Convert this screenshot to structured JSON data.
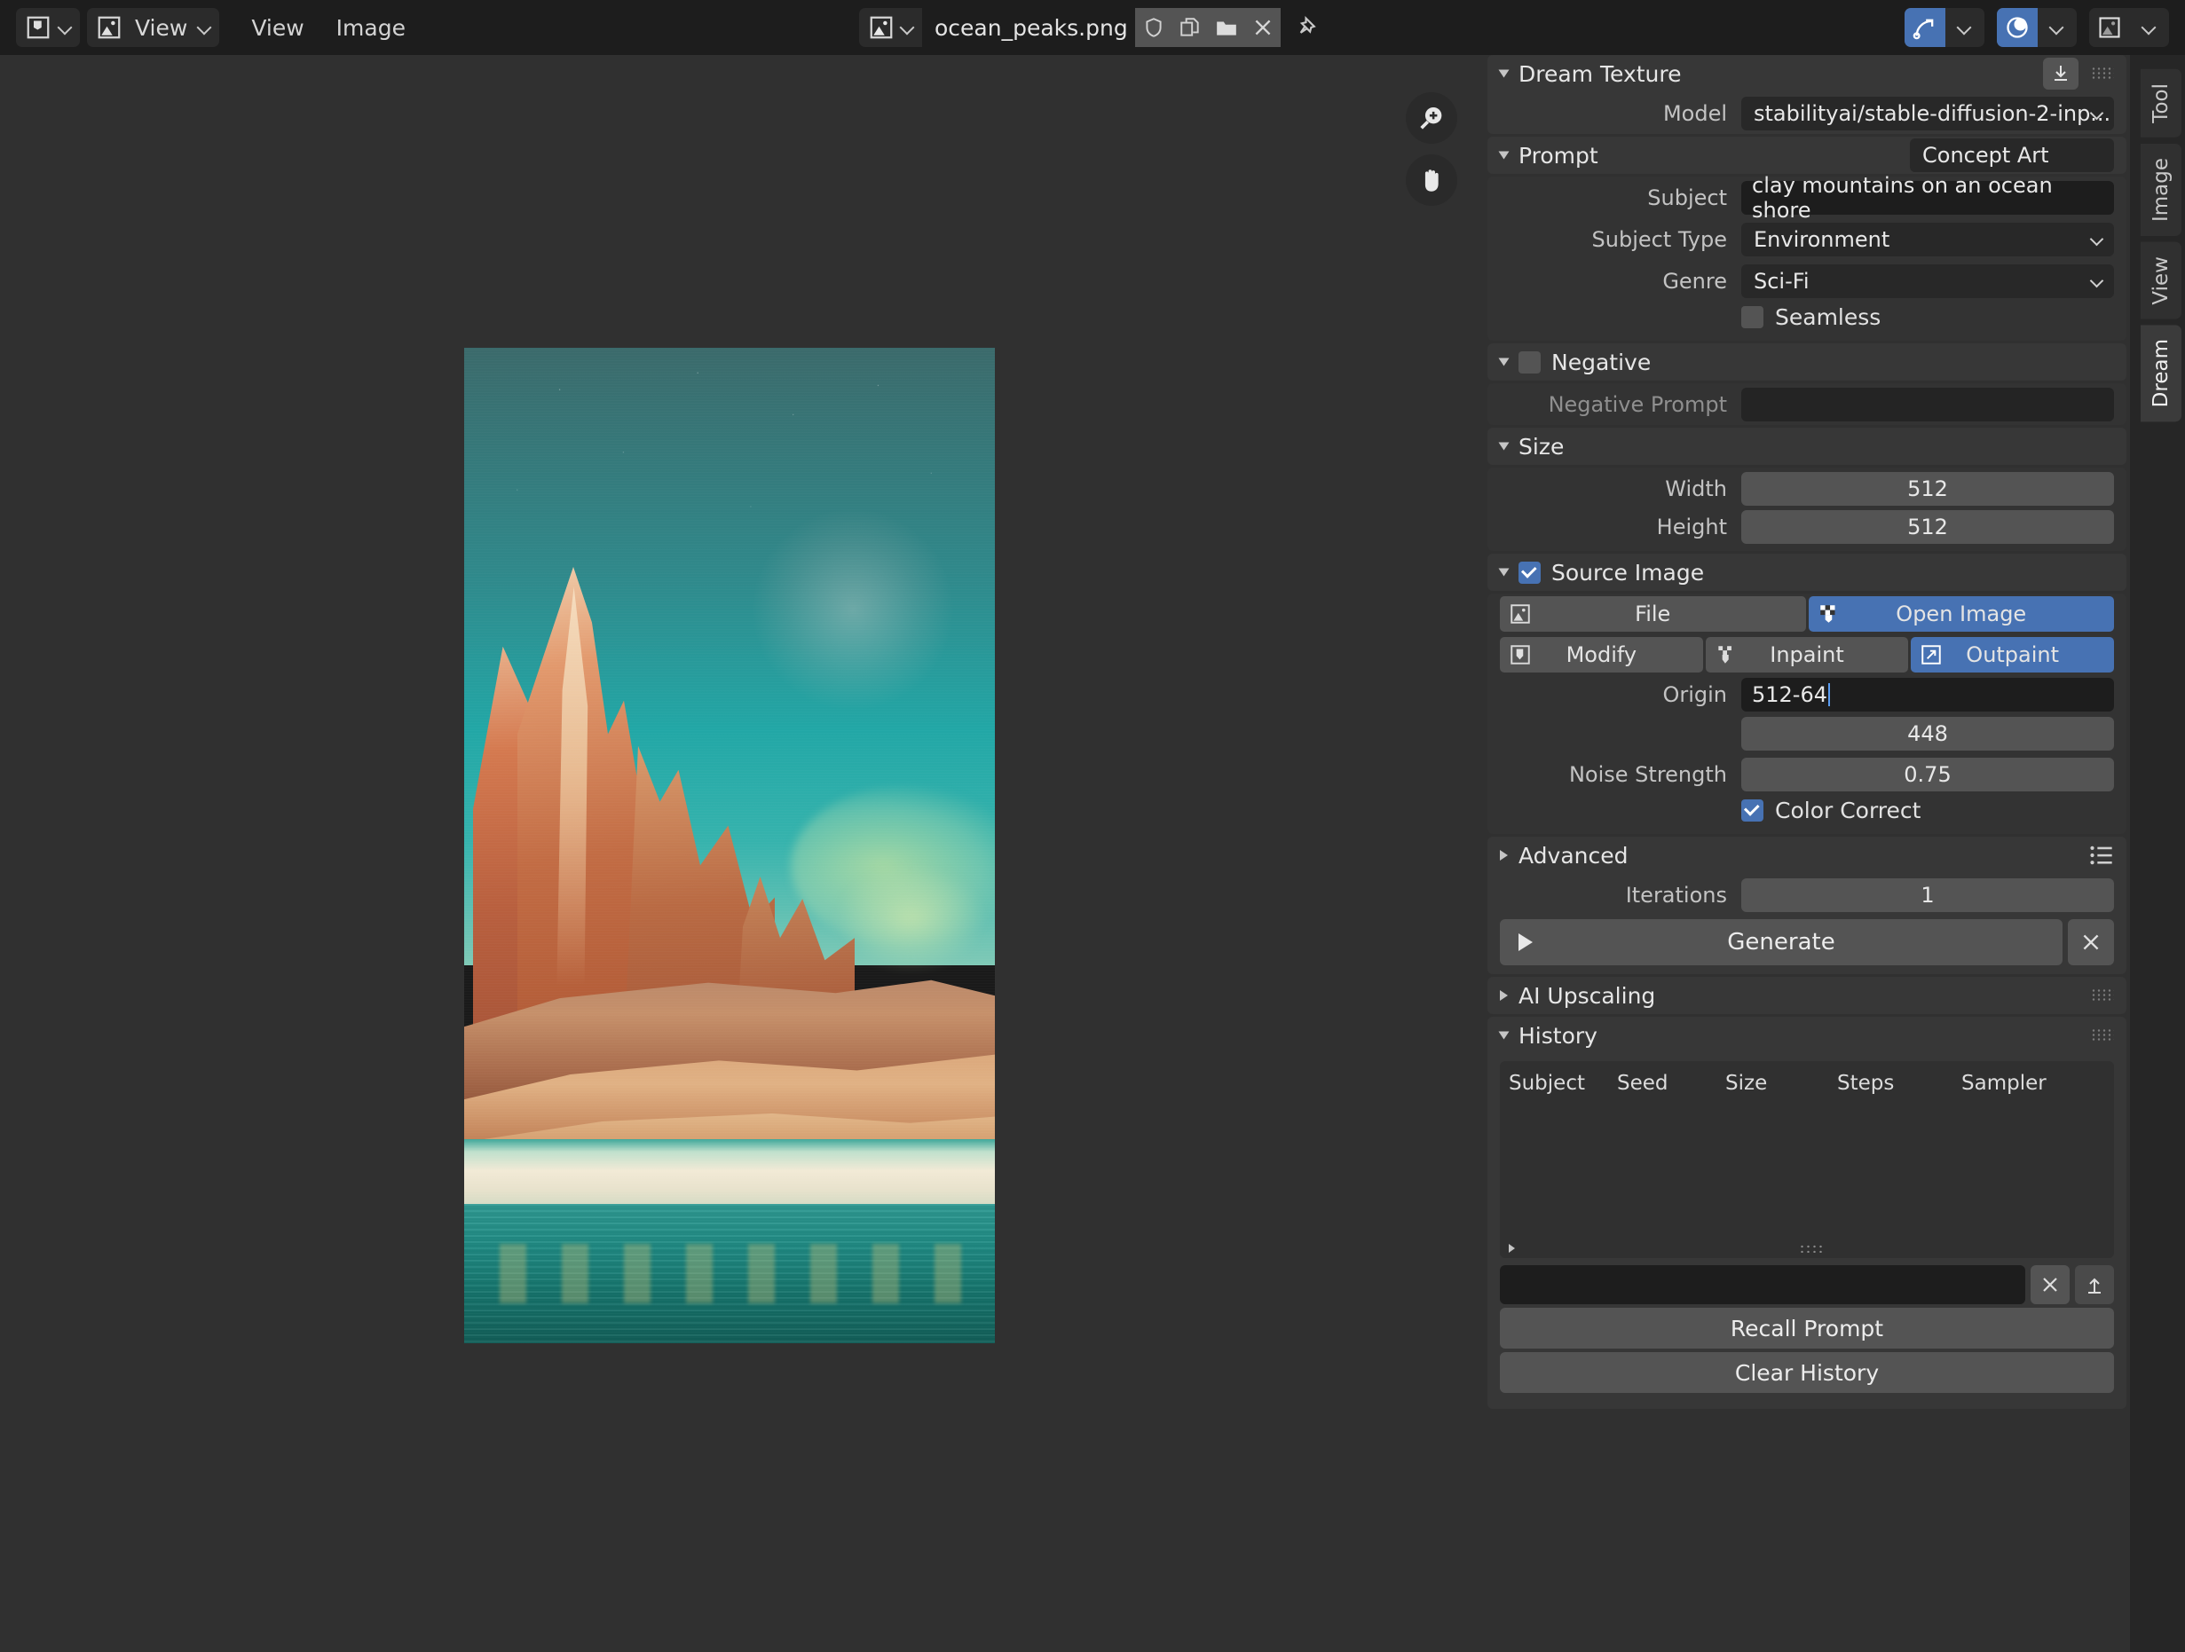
{
  "header": {
    "editor_type_icon": "image-paint-editor-icon",
    "view_mode_label": "View",
    "menus": [
      "View",
      "Image"
    ],
    "image_datablock_icon": "image-data-icon",
    "image_name": "ocean_peaks.png",
    "buttons": [
      {
        "name": "fake-user-shield-button",
        "icon": "shield-icon"
      },
      {
        "name": "new-image-copy-button",
        "icon": "copy-icon"
      },
      {
        "name": "open-image-folder-button",
        "icon": "folder-icon"
      },
      {
        "name": "unlink-image-button",
        "icon": "close-x-icon"
      }
    ],
    "pin_icon": "pin-icon",
    "right_toggles": [
      {
        "name": "gizmo-toggle",
        "icon": "curve-arrow-icon",
        "active": true
      },
      {
        "name": "overlays-toggle",
        "icon": "sphere-overlay-icon",
        "active": true
      },
      {
        "name": "image-display-toggle",
        "icon": "image-icon",
        "active": false
      }
    ]
  },
  "canvas": {
    "region_expand_icon": "chevron-right-icon",
    "gizmos": [
      {
        "name": "zoom-gizmo",
        "icon": "magnifier-plus-icon"
      },
      {
        "name": "pan-gizmo",
        "icon": "hand-icon"
      }
    ],
    "image_alt": "clay mountain peaks on a teal ocean shore concept art"
  },
  "panel": {
    "title": "Dream Texture",
    "import_icon": "download-icon",
    "model": {
      "label": "Model",
      "value": "stabilityai/stable-diffusion-2-inp..."
    },
    "prompt": {
      "title": "Prompt",
      "preset": "Concept Art",
      "subject_label": "Subject",
      "subject_value": "clay mountains on an ocean shore",
      "subject_type_label": "Subject Type",
      "subject_type_value": "Environment",
      "genre_label": "Genre",
      "genre_value": "Sci-Fi",
      "seamless_label": "Seamless",
      "seamless_checked": false
    },
    "negative": {
      "title": "Negative",
      "enabled": false,
      "prompt_label": "Negative Prompt",
      "prompt_value": ""
    },
    "size": {
      "title": "Size",
      "width_label": "Width",
      "width_value": "512",
      "height_label": "Height",
      "height_value": "512"
    },
    "source_image": {
      "title": "Source Image",
      "enabled": true,
      "source_row": [
        {
          "label": "File",
          "icon": "image-file-icon",
          "active": false
        },
        {
          "label": "Open Image",
          "icon": "checker-paint-icon",
          "active": true
        }
      ],
      "action_row": [
        {
          "label": "Modify",
          "icon": "paint-icon",
          "active": false
        },
        {
          "label": "Inpaint",
          "icon": "checker-paint-icon",
          "active": false
        },
        {
          "label": "Outpaint",
          "icon": "expand-arrows-icon",
          "active": true
        }
      ],
      "origin_label": "Origin",
      "origin_x": "512-64",
      "origin_y": "448",
      "noise_label": "Noise Strength",
      "noise_value": "0.75",
      "color_correct_label": "Color Correct",
      "color_correct_checked": true
    },
    "advanced": {
      "title": "Advanced",
      "preset_icon": "preset-list-icon"
    },
    "iterations": {
      "label": "Iterations",
      "value": "1"
    },
    "generate": {
      "label": "Generate",
      "play_icon": "play-icon",
      "cancel_icon": "close-x-icon"
    },
    "ai_upscaling": {
      "title": "AI Upscaling"
    },
    "history": {
      "title": "History",
      "columns": [
        "Subject",
        "Seed",
        "Size",
        "Steps",
        "Sampler"
      ],
      "rows": [],
      "search_value": "",
      "clear_search_icon": "close-x-icon",
      "export_icon": "upload-icon",
      "recall_label": "Recall Prompt",
      "clear_label": "Clear History"
    }
  },
  "tabs": [
    {
      "label": "Tool",
      "active": false
    },
    {
      "label": "Image",
      "active": false
    },
    {
      "label": "View",
      "active": false
    },
    {
      "label": "Dream",
      "active": true
    }
  ],
  "colors": {
    "accent_blue": "#4772b3",
    "panel_bg": "#303030",
    "header_bg": "#1d1d1d",
    "field_bg": "#545454",
    "text_field_bg": "#1d1d1d"
  }
}
